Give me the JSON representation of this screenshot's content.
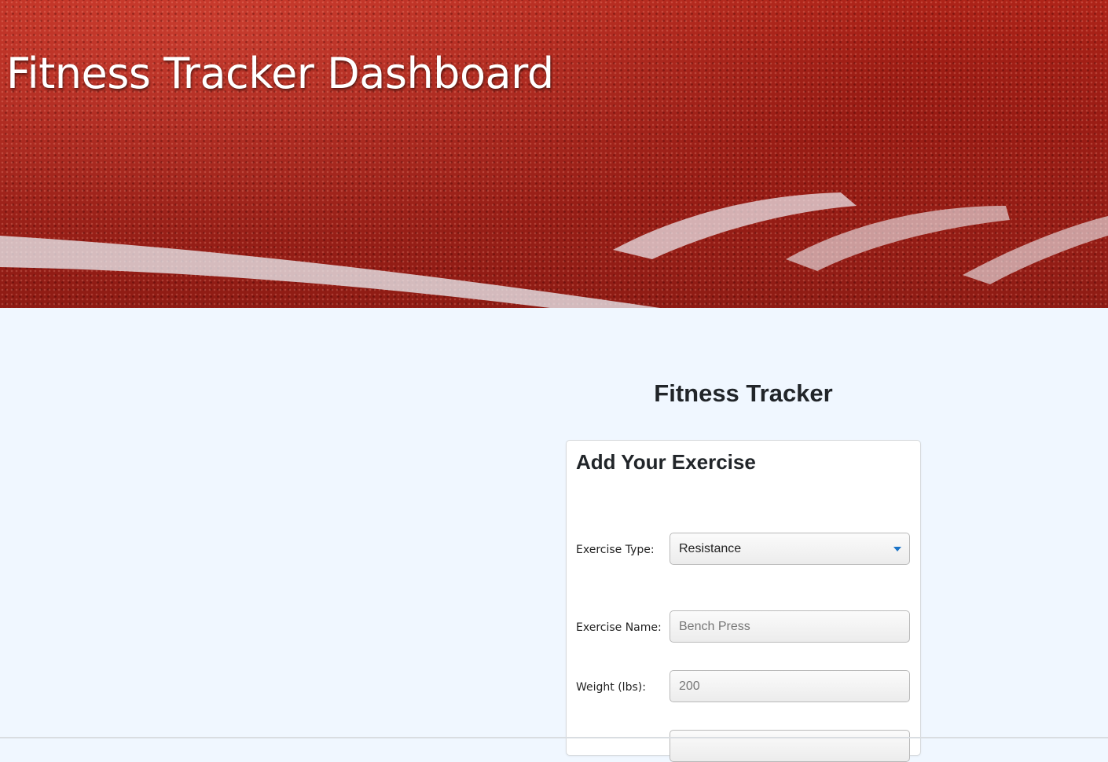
{
  "header": {
    "title": "Fitness Tracker Dashboard"
  },
  "main": {
    "title": "Fitness Tracker"
  },
  "form": {
    "card_title": "Add Your Exercise",
    "exercise_type": {
      "label": "Exercise Type:",
      "selected": "Resistance"
    },
    "exercise_name": {
      "label": "Exercise Name:",
      "placeholder": "Bench Press"
    },
    "weight": {
      "label": "Weight (lbs):",
      "placeholder": "200"
    }
  },
  "colors": {
    "page_background": "#f0f7ff",
    "hero_red": "#a8231a",
    "select_caret": "#1a73c7"
  }
}
